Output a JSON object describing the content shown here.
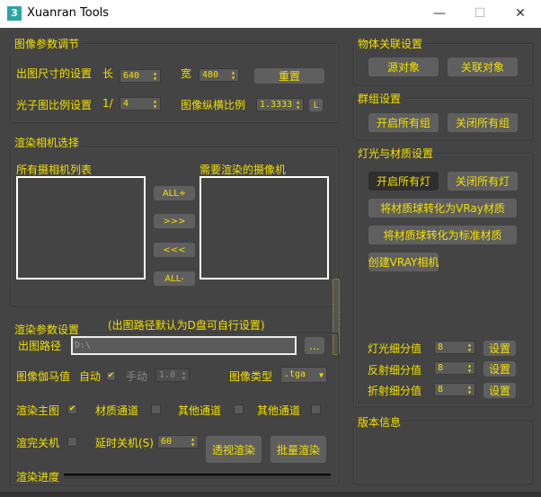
{
  "window": {
    "title": "Xuanran Tools",
    "app_icon": "3",
    "minimize": "—",
    "maximize": "☐",
    "close": "✕"
  },
  "image_params": {
    "title": "图像参数调节",
    "size_label": "出图尺寸的设置",
    "length_label": "长",
    "length": "640",
    "width_label": "宽",
    "width": "480",
    "reset": "重置",
    "photon_label": "光子图比例设置",
    "photon_prefix": "1/",
    "photon": "4",
    "aspect_label": "图像纵横比例",
    "aspect": "1.3333",
    "lock": "L"
  },
  "camera": {
    "title": "渲染相机选择",
    "all_label": "所有摄相机列表",
    "render_label": "需要渲染的摄像机",
    "all_add": "ALL+",
    "add": ">>>",
    "remove": "<<<",
    "all_remove": "ALL-"
  },
  "render": {
    "title": "渲染参数设置",
    "note": "(出图路径默认为D盘可自行设置)",
    "path_label": "出图路径",
    "path": "D:\\",
    "browse": "...",
    "gamma_label": "图像伽马值",
    "auto_label": "自动",
    "auto_checked": true,
    "manual_label": "手动",
    "gamma": "1.0",
    "type_label": "图像类型",
    "type": ".tga",
    "main_label": "渲染主图",
    "main_checked": true,
    "material_label": "材质通道",
    "other1_label": "其他通道",
    "other2_label": "其他通道",
    "shutdown_label": "渲完关机",
    "delay_label": "延时关机(S)",
    "delay": "60",
    "persp": "透视渲染",
    "batch": "批量渲染",
    "progress_label": "渲染进度",
    "progress": 0
  },
  "object": {
    "title": "物体关联设置",
    "source": "源对象",
    "link": "关联对象"
  },
  "group": {
    "title": "群组设置",
    "open": "开启所有组",
    "close": "关闭所有组"
  },
  "light": {
    "title": "灯光与材质设置",
    "on": "开启所有灯",
    "off": "关闭所有灯",
    "to_vray": "将材质球转化为VRay材质",
    "to_std": "将材质球转化为标准材质",
    "create_cam": "创建VRAY相机",
    "light_sub": "灯光细分值",
    "light_val": "8",
    "refl_sub": "反射细分值",
    "refl_val": "8",
    "refr_sub": "折射细分值",
    "refr_val": "8",
    "set": "设置"
  },
  "version": {
    "title": "版本信息"
  },
  "colors": {
    "text": "#f2e000",
    "bg": "#444444",
    "button": "#5f5f5f"
  }
}
